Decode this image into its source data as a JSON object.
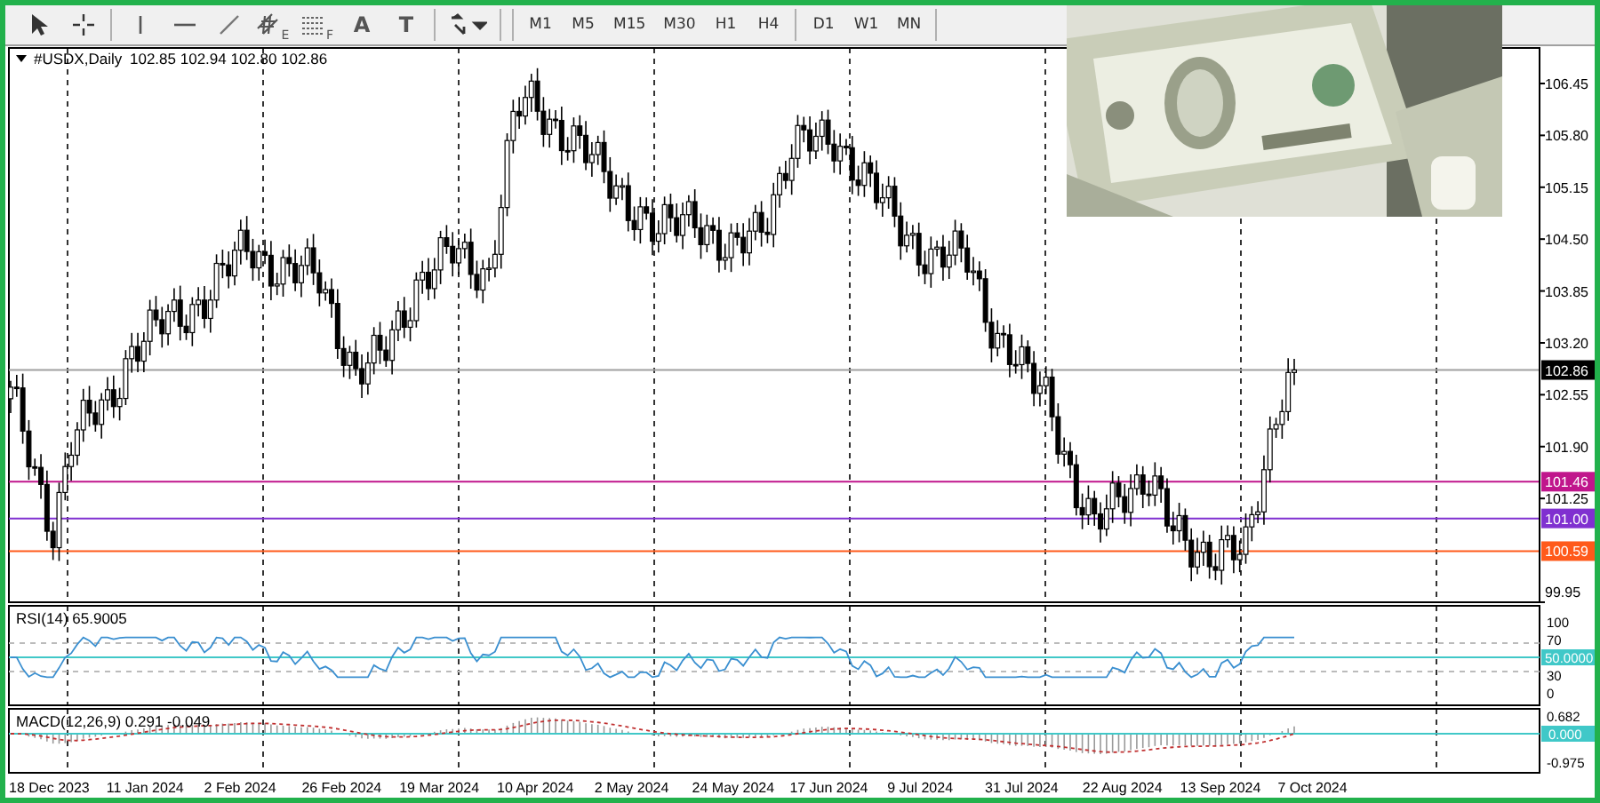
{
  "toolbar": {
    "tools": [
      {
        "kind": "cursor"
      },
      {
        "kind": "crosshair"
      },
      {
        "kind": "vline"
      },
      {
        "kind": "hline"
      },
      {
        "kind": "trend"
      },
      {
        "kind": "channel",
        "label": "E"
      },
      {
        "kind": "fibo",
        "label": "F"
      },
      {
        "kind": "text",
        "label": "A"
      },
      {
        "kind": "textlabel",
        "label": "T"
      },
      {
        "kind": "arrows"
      }
    ],
    "timeframes": [
      "M1",
      "M5",
      "M15",
      "M30",
      "H1",
      "H4",
      "D1",
      "W1",
      "MN"
    ]
  },
  "chart": {
    "symbol": "#USDX,Daily",
    "ohlc": "102.85 102.94 102.80 102.86",
    "price_ticks": [
      "106.45",
      "105.80",
      "105.15",
      "104.50",
      "103.85",
      "103.20",
      "102.55",
      "101.90",
      "101.25",
      "99.95"
    ],
    "price_levels": [
      {
        "kind": "current",
        "label": "102.86",
        "color": "#000000"
      },
      {
        "kind": "level",
        "label": "101.46",
        "color": "#c0168c"
      },
      {
        "kind": "level",
        "label": "101.00",
        "color": "#8030d0"
      },
      {
        "kind": "level",
        "label": "100.59",
        "color": "#ff5a1a"
      }
    ],
    "dates": [
      "18 Dec 2023",
      "11 Jan 2024",
      "2 Feb 2024",
      "26 Feb 2024",
      "19 Mar 2024",
      "10 Apr 2024",
      "2 May 2024",
      "24 May 2024",
      "17 Jun 2024",
      "9 Jul 2024",
      "31 Jul 2024",
      "22 Aug 2024",
      "13 Sep 2024",
      "7 Oct 2024"
    ]
  },
  "rsi": {
    "label": "RSI(14) 65.9005",
    "ticks": [
      "100",
      "70",
      "30",
      "0"
    ],
    "level_label": "50.0000"
  },
  "macd": {
    "label": "MACD(12,26,9) 0.291 -0.049",
    "ticks": [
      "0.682",
      "-0.975"
    ],
    "zero_label": "0.000"
  }
}
